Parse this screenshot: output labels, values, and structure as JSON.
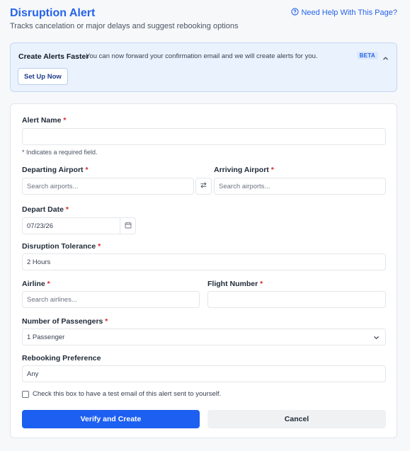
{
  "header": {
    "title": "Disruption Alert",
    "subtitle": "Tracks cancelation or major delays and suggest rebooking options",
    "help_link": "Need Help With This Page?"
  },
  "banner": {
    "title": "Create Alerts Faster",
    "text": "You can now forward your confirmation email and we will create alerts for you.",
    "badge": "BETA",
    "button": "Set Up Now"
  },
  "form": {
    "required_mark": "*",
    "alert_name": {
      "label": "Alert Name",
      "value": ""
    },
    "required_hint": "* Indicates a required field.",
    "departing": {
      "label": "Departing Airport",
      "placeholder": "Search airports..."
    },
    "arriving": {
      "label": "Arriving Airport",
      "placeholder": "Search airports..."
    },
    "depart_date": {
      "label": "Depart Date",
      "value": "07/23/26"
    },
    "tolerance": {
      "label": "Disruption Tolerance",
      "value": "2 Hours"
    },
    "airline": {
      "label": "Airline",
      "placeholder": "Search airlines..."
    },
    "flight_number": {
      "label": "Flight Number",
      "value": ""
    },
    "passengers": {
      "label": "Number of Passengers",
      "value": "1 Passenger"
    },
    "rebooking": {
      "label": "Rebooking Preference",
      "value": "Any"
    },
    "test_email_label": "Check this box to have a test email of this alert sent to yourself.",
    "submit": "Verify and Create",
    "cancel": "Cancel"
  },
  "icons": {
    "help": "question-circle-icon",
    "collapse": "chevron-up-icon",
    "swap": "swap-arrows-icon",
    "calendar": "calendar-icon",
    "dropdown": "chevron-down-icon"
  },
  "colors": {
    "accent": "#2563eb",
    "primary_button": "#1d5ff0",
    "required": "#dc2626",
    "banner_bg": "#eaf2fd"
  }
}
